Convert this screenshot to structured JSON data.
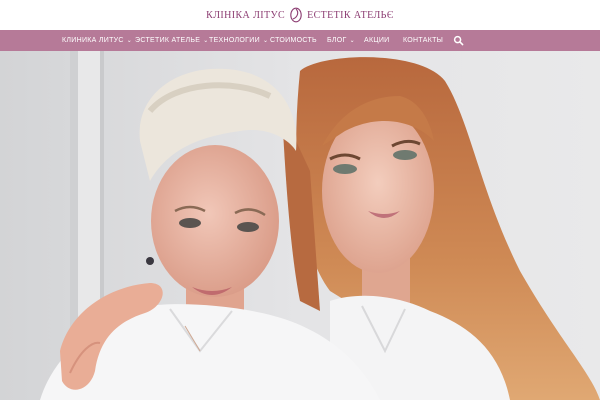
{
  "site": {
    "logo_left": "КЛІНІКА ЛІТУС",
    "logo_right": "ЕСТЕТІК АТЕЛЬЄ"
  },
  "nav": {
    "items": [
      {
        "label": "КЛИНИКА ЛИТУС",
        "has_dropdown": true
      },
      {
        "label": "ЭСТЕТИК АТЕЛЬЕ",
        "has_dropdown": true
      },
      {
        "label": "ТЕХНОЛОГИИ",
        "has_dropdown": true
      },
      {
        "label": "СТОИМОСТЬ",
        "has_dropdown": false
      },
      {
        "label": "БЛОГ",
        "has_dropdown": true
      },
      {
        "label": "АКЦИИ",
        "has_dropdown": false
      },
      {
        "label": "КОНТАКТЫ",
        "has_dropdown": false
      }
    ],
    "dropdown_icon": "chevron-down-icon",
    "search_icon": "search-icon"
  },
  "colors": {
    "brand": "#8c3d72",
    "nav_background": "#b67a98",
    "nav_text": "#ffffff"
  }
}
